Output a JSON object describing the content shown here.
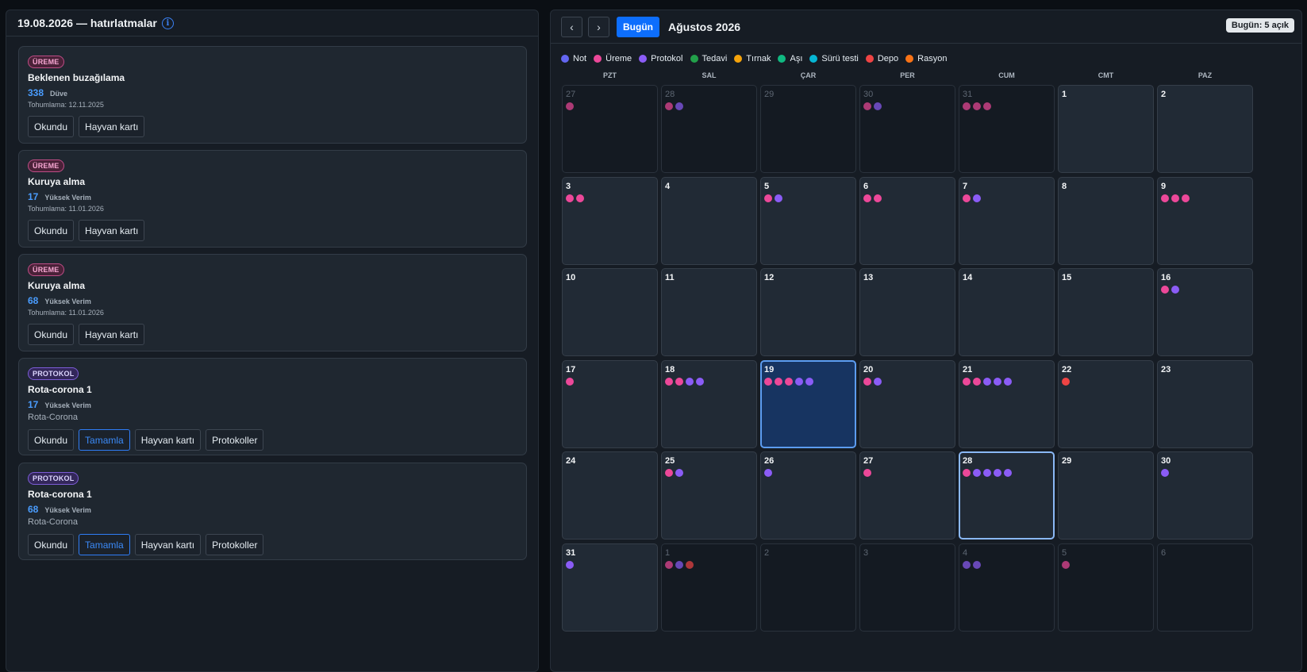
{
  "left": {
    "title": "19.08.2026 — hatırlatmalar",
    "info_icon": "i",
    "cards": [
      {
        "badge": "ÜREME",
        "kind": "ureme",
        "title": "Beklenen buzağılama",
        "animal_id": "338",
        "group": "Düve",
        "sub": "Tohumlama: 12.11.2025",
        "buttons": [
          "Okundu",
          "Hayvan kartı"
        ]
      },
      {
        "badge": "ÜREME",
        "kind": "ureme",
        "title": "Kuruya alma",
        "animal_id": "17",
        "group": "Yüksek Verim",
        "sub": "Tohumlama: 11.01.2026",
        "buttons": [
          "Okundu",
          "Hayvan kartı"
        ]
      },
      {
        "badge": "ÜREME",
        "kind": "ureme",
        "title": "Kuruya alma",
        "animal_id": "68",
        "group": "Yüksek Verim",
        "sub": "Tohumlama: 11.01.2026",
        "buttons": [
          "Okundu",
          "Hayvan kartı"
        ]
      },
      {
        "badge": "PROTOKOL",
        "kind": "protokol",
        "title": "Rota-corona 1",
        "animal_id": "17",
        "group": "Yüksek Verim",
        "sub": "Rota-Corona",
        "buttons": [
          "Okundu",
          "Tamamla",
          "Hayvan kartı",
          "Protokoller"
        ]
      },
      {
        "badge": "PROTOKOL",
        "kind": "protokol",
        "title": "Rota-corona 1",
        "animal_id": "68",
        "group": "Yüksek Verim",
        "sub": "Rota-Corona",
        "buttons": [
          "Okundu",
          "Tamamla",
          "Hayvan kartı",
          "Protokoller"
        ]
      }
    ]
  },
  "calendar": {
    "prev_icon": "‹",
    "next_icon": "›",
    "today_label": "Bugün",
    "month_title": "Ağustos 2026",
    "open_badge": "Bugün: 5 açık",
    "legend": [
      {
        "label": "Not",
        "color": "#6366f1"
      },
      {
        "label": "Üreme",
        "color": "#ec4899"
      },
      {
        "label": "Protokol",
        "color": "#8b5cf6"
      },
      {
        "label": "Tedavi",
        "color": "#22a04a"
      },
      {
        "label": "Tırnak",
        "color": "#f5a30b"
      },
      {
        "label": "Aşı",
        "color": "#10b981"
      },
      {
        "label": "Sürü testi",
        "color": "#06b6d4"
      },
      {
        "label": "Depo",
        "color": "#ef4444"
      },
      {
        "label": "Rasyon",
        "color": "#f97316"
      }
    ],
    "weekdays": [
      "PZT",
      "SAL",
      "ÇAR",
      "PER",
      "CUM",
      "CMT",
      "PAZ"
    ],
    "days": [
      {
        "n": "27",
        "out": true,
        "dots": [
          "ureme"
        ]
      },
      {
        "n": "28",
        "out": true,
        "dots": [
          "ureme",
          "protokol"
        ]
      },
      {
        "n": "29",
        "out": true,
        "dots": []
      },
      {
        "n": "30",
        "out": true,
        "dots": [
          "ureme",
          "protokol"
        ]
      },
      {
        "n": "31",
        "out": true,
        "dots": [
          "ureme",
          "ureme",
          "ureme"
        ]
      },
      {
        "n": "1",
        "dots": []
      },
      {
        "n": "2",
        "dots": []
      },
      {
        "n": "3",
        "dots": [
          "ureme",
          "ureme"
        ]
      },
      {
        "n": "4",
        "dots": []
      },
      {
        "n": "5",
        "dots": [
          "ureme",
          "protokol"
        ]
      },
      {
        "n": "6",
        "dots": [
          "ureme",
          "ureme"
        ]
      },
      {
        "n": "7",
        "dots": [
          "ureme",
          "protokol"
        ]
      },
      {
        "n": "8",
        "dots": []
      },
      {
        "n": "9",
        "dots": [
          "ureme",
          "ureme",
          "ureme"
        ]
      },
      {
        "n": "10",
        "dots": []
      },
      {
        "n": "11",
        "dots": []
      },
      {
        "n": "12",
        "dots": []
      },
      {
        "n": "13",
        "dots": []
      },
      {
        "n": "14",
        "dots": []
      },
      {
        "n": "15",
        "dots": []
      },
      {
        "n": "16",
        "dots": [
          "ureme",
          "protokol"
        ]
      },
      {
        "n": "17",
        "dots": [
          "ureme"
        ]
      },
      {
        "n": "18",
        "dots": [
          "ureme",
          "ureme",
          "protokol",
          "protokol"
        ]
      },
      {
        "n": "19",
        "today": true,
        "dots": [
          "ureme",
          "ureme",
          "ureme",
          "protokol",
          "protokol"
        ]
      },
      {
        "n": "20",
        "dots": [
          "ureme",
          "protokol"
        ]
      },
      {
        "n": "21",
        "dots": [
          "ureme",
          "ureme",
          "protokol",
          "protokol",
          "protokol"
        ]
      },
      {
        "n": "22",
        "dots": [
          "depo"
        ]
      },
      {
        "n": "23",
        "dots": []
      },
      {
        "n": "24",
        "dots": []
      },
      {
        "n": "25",
        "dots": [
          "ureme",
          "protokol"
        ]
      },
      {
        "n": "26",
        "dots": [
          "protokol"
        ]
      },
      {
        "n": "27",
        "dots": [
          "ureme"
        ]
      },
      {
        "n": "28",
        "selected": true,
        "dots": [
          "ureme",
          "protokol",
          "protokol",
          "protokol",
          "protokol"
        ]
      },
      {
        "n": "29",
        "dots": []
      },
      {
        "n": "30",
        "dots": [
          "protokol"
        ]
      },
      {
        "n": "31",
        "dots": [
          "protokol"
        ]
      },
      {
        "n": "1",
        "out": true,
        "dots": [
          "ureme",
          "protokol",
          "depo"
        ]
      },
      {
        "n": "2",
        "out": true,
        "dots": []
      },
      {
        "n": "3",
        "out": true,
        "dots": []
      },
      {
        "n": "4",
        "out": true,
        "dots": [
          "protokol",
          "protokol"
        ]
      },
      {
        "n": "5",
        "out": true,
        "dots": [
          "ureme"
        ]
      },
      {
        "n": "6",
        "out": true,
        "dots": []
      }
    ]
  },
  "colors": {
    "ureme": "#ec4899",
    "protokol": "#8b5cf6",
    "depo": "#ef4444"
  }
}
